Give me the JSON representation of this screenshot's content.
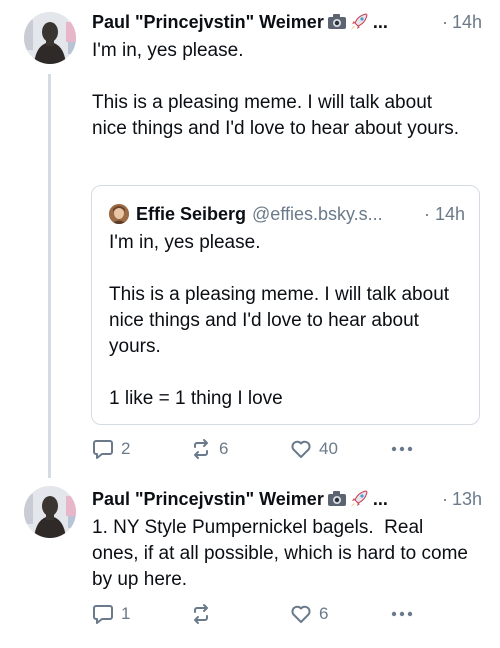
{
  "posts": [
    {
      "author": "Paul \"Princejvstin\" Weimer",
      "badges": [
        "camera-emoji",
        "rocket-emoji"
      ],
      "ellipsis": "...",
      "dot": "·",
      "time": "14h",
      "paragraphs": [
        "I'm in, yes please.",
        "This is a pleasing meme. I will talk about nice things and I'd love to hear about yours."
      ],
      "quote": {
        "name": "Effie Seiberg",
        "handle": "@effies.bsky.s...",
        "time": "· 14h",
        "paragraphs": [
          "I'm in, yes please.",
          "This is a pleasing meme. I will talk about nice things and I'd love to hear about yours.",
          "1 like = 1 thing I love"
        ]
      },
      "actions": {
        "replies": "2",
        "reposts": "6",
        "likes": "40"
      }
    },
    {
      "author": "Paul \"Princejvstin\" Weimer",
      "badges": [
        "camera-emoji",
        "rocket-emoji"
      ],
      "ellipsis": "...",
      "dot": "·",
      "time": "13h",
      "paragraphs": [
        "1. NY Style Pumpernickel bagels.  Real ones, if at all possible, which is hard to come by up here."
      ],
      "actions": {
        "replies": "1",
        "reposts": "",
        "likes": "6"
      }
    }
  ],
  "colors": {
    "muted": "#6b7a8a",
    "border": "#d4dbe2",
    "text": "#0b0f14"
  }
}
